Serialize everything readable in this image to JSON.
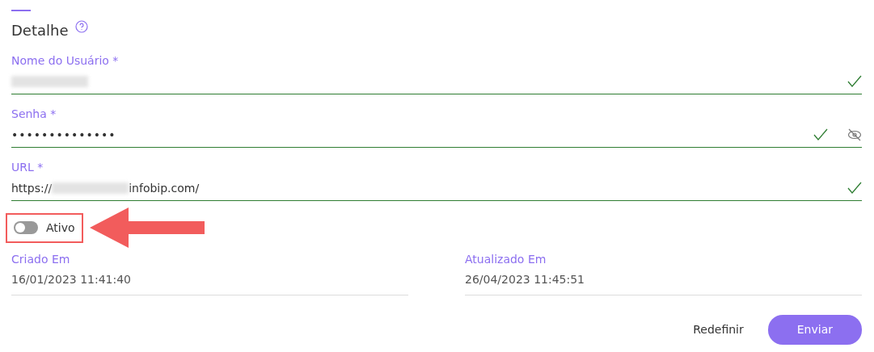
{
  "title": "Detalhe",
  "fields": [
    {
      "kind": "text",
      "label": "Nome do Usuário *",
      "value_parts": [
        {
          "kind": "redacted"
        }
      ],
      "valid": true,
      "reveal_toggle": false
    },
    {
      "kind": "password",
      "label": "Senha *",
      "value_parts": [
        {
          "kind": "text",
          "text": "••••••••••••••"
        }
      ],
      "valid": true,
      "reveal_toggle": true
    },
    {
      "kind": "text",
      "label": "URL *",
      "value_parts": [
        {
          "kind": "text",
          "text": "https://"
        },
        {
          "kind": "redacted"
        },
        {
          "kind": "text",
          "text": "infobip.com/"
        }
      ],
      "valid": true,
      "reveal_toggle": false
    }
  ],
  "switch": {
    "label": "Ativo",
    "on": false,
    "highlighted": true
  },
  "dates": [
    {
      "label": "Criado Em",
      "value": "16/01/2023 11:41:40"
    },
    {
      "label": "Atualizado Em",
      "value": "26/04/2023 11:45:51"
    }
  ],
  "buttons": [
    {
      "kind": "link",
      "label": "Redefinir"
    },
    {
      "kind": "primary",
      "label": "Enviar"
    }
  ]
}
